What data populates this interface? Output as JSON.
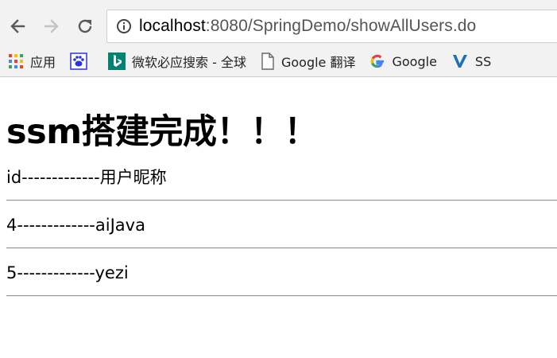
{
  "browser": {
    "url_host": "localhost",
    "url_rest": ":8080/SpringDemo/showAllUsers.do",
    "bookmarks": [
      {
        "label": "应用",
        "icon": "apps-grid-icon"
      },
      {
        "label": "",
        "icon": "baidu-paw-icon"
      },
      {
        "label": "微软必应搜索 - 全球",
        "icon": "bing-icon"
      },
      {
        "label": "Google 翻译",
        "icon": "page-icon"
      },
      {
        "label": "Google",
        "icon": "google-icon"
      },
      {
        "label": "SS",
        "icon": "v-logo-icon"
      }
    ]
  },
  "page": {
    "title": "ssm搭建完成！！！",
    "rows": [
      "id-------------用户昵称",
      "4-------------aiJava",
      "5-------------yezi"
    ]
  },
  "colors": {
    "chrome_bg": "#f2f2f2",
    "google_blue": "#4285f4",
    "bing_teal": "#008373",
    "baidu_blue": "#2932e1"
  }
}
